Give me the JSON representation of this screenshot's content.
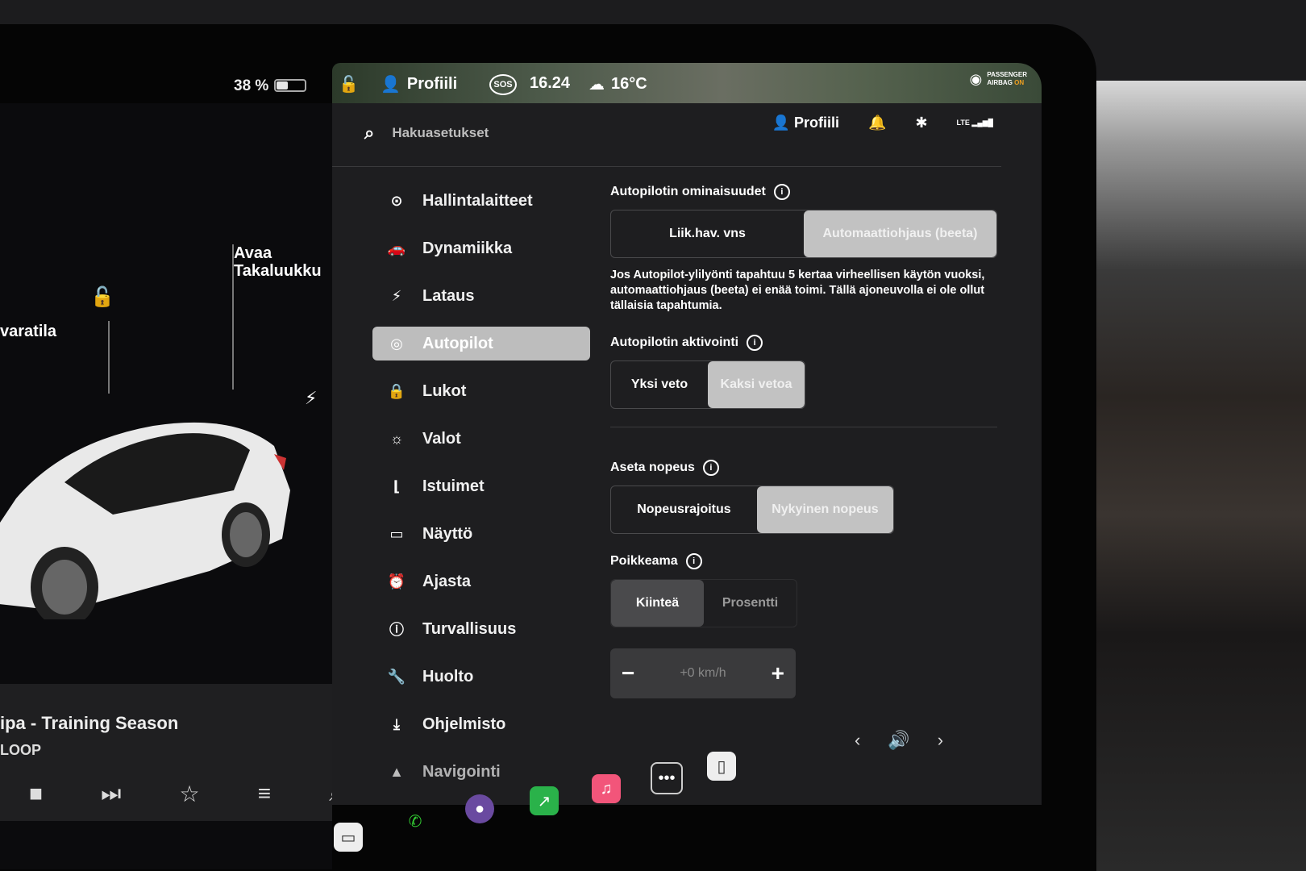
{
  "status_bar": {
    "battery_text": "38 %",
    "battery_level": 0.38,
    "profile_label": "Profiili",
    "sos_label": "SOS",
    "time": "16.24",
    "temperature": "16°C",
    "airbag_line1": "PASSENGER",
    "airbag_line2": "AIRBAG",
    "airbag_state": "ON"
  },
  "car_panel": {
    "callout_trunk_1": "Avaa",
    "callout_trunk_2": "Takaluukku",
    "callout_left": "varatila"
  },
  "media": {
    "track": "ipa - Training Season",
    "source": "LOOP"
  },
  "settings": {
    "search_placeholder": "Hakuasetukset",
    "profile_label": "Profiili",
    "lte_label": "LTE",
    "nav": [
      {
        "label": "Hallintalaitteet",
        "icon": "toggle-icon"
      },
      {
        "label": "Dynamiikka",
        "icon": "car-icon"
      },
      {
        "label": "Lataus",
        "icon": "bolt-icon"
      },
      {
        "label": "Autopilot",
        "icon": "steering-wheel-icon",
        "active": true
      },
      {
        "label": "Lukot",
        "icon": "lock-icon"
      },
      {
        "label": "Valot",
        "icon": "sun-icon"
      },
      {
        "label": "Istuimet",
        "icon": "seat-icon"
      },
      {
        "label": "Näyttö",
        "icon": "display-icon"
      },
      {
        "label": "Ajasta",
        "icon": "alarm-clock-icon"
      },
      {
        "label": "Turvallisuus",
        "icon": "alert-icon"
      },
      {
        "label": "Huolto",
        "icon": "wrench-icon"
      },
      {
        "label": "Ohjelmisto",
        "icon": "download-icon"
      },
      {
        "label": "Navigointi",
        "icon": "navigation-icon"
      }
    ],
    "autopilot_features": {
      "title": "Autopilotin ominaisuudet",
      "option_1": "Liik.hav. vns",
      "option_2": "Automaattiohjaus (beeta)",
      "selected": 2,
      "note": "Jos Autopilot-ylilyönti tapahtuu 5 kertaa virheellisen käytön vuoksi, automaattiohjaus (beeta) ei enää toimi. Tällä ajoneuvolla ei ole ollut tällaisia tapahtumia."
    },
    "autopilot_activation": {
      "title": "Autopilotin aktivointi",
      "option_1": "Yksi veto",
      "option_2": "Kaksi vetoa",
      "selected": 2
    },
    "set_speed": {
      "title": "Aseta nopeus",
      "option_1": "Nopeusrajoitus",
      "option_2": "Nykyinen nopeus",
      "selected": 2
    },
    "offset": {
      "title": "Poikkeama",
      "option_1": "Kiinteä",
      "option_2": "Prosentti",
      "selected": 1,
      "value": "+0 km/h",
      "minus": "−",
      "plus": "+"
    }
  }
}
